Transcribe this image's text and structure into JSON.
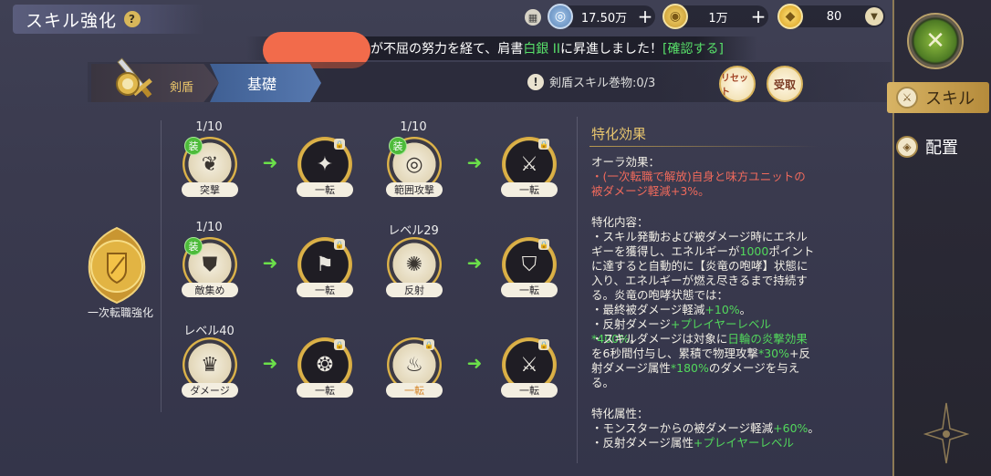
{
  "header": {
    "title": "スキル強化",
    "help_icon": "?"
  },
  "currencies": {
    "silver": {
      "value": "17.50万"
    },
    "gold": {
      "value": "1万"
    },
    "gem": {
      "value": "80"
    }
  },
  "notice": {
    "text_before": "が不屈の努力を経て、肩書",
    "rank": "白銀 II",
    "text_after": "に昇進しました！",
    "confirm": "[確認する]"
  },
  "tabs": [
    {
      "label": "剣盾"
    },
    {
      "label": "基礎"
    }
  ],
  "scroll_info": "剣盾スキル巻物:0/3",
  "buttons": {
    "reset": "リセット",
    "receive": "受取"
  },
  "left_emblem_label": "一次転職強化",
  "skill_rows": [
    {
      "cells": [
        {
          "level": "1/10",
          "name": "突撃",
          "equipped": "装",
          "style": "gold"
        },
        {
          "level": "",
          "name": "一転",
          "style": "dark"
        },
        {
          "level": "1/10",
          "name": "範囲攻撃",
          "equipped": "装",
          "style": "gold"
        },
        {
          "level": "",
          "name": "一転",
          "style": "dark"
        }
      ]
    },
    {
      "cells": [
        {
          "level": "1/10",
          "name": "敵集め",
          "equipped": "装",
          "style": "gold"
        },
        {
          "level": "",
          "name": "一転",
          "style": "dark"
        },
        {
          "level": "レベル29",
          "name": "反射",
          "style": "gold"
        },
        {
          "level": "",
          "name": "一転",
          "style": "dark"
        }
      ]
    },
    {
      "cells": [
        {
          "level": "レベル40",
          "name": "ダメージ",
          "style": "gold"
        },
        {
          "level": "",
          "name": "一転",
          "style": "dark"
        },
        {
          "level": "",
          "name": "一転",
          "style": "gold",
          "active": true
        },
        {
          "level": "",
          "name": "一転",
          "style": "dark"
        }
      ]
    }
  ],
  "panel": {
    "title": "特化効果",
    "aura_heading": "オーラ効果：",
    "aura_line1": "・(一次転職で解放)自身と味方ユニットの",
    "aura_line2": "被ダメージ軽減+3%。",
    "content_heading": "特化内容：",
    "c1": "・スキル発動および被ダメージ時にエネル",
    "c2a": "ギーを獲得し、エネルギーが",
    "c2b": "1000",
    "c2c": "ポイント",
    "c3": "に達すると自動的に【炎竜の咆哮】状態に",
    "c4": "入り、エネルギーが燃え尽きるまで持続す",
    "c5": "る。炎竜の咆哮状態では：",
    "c6a": "・最終被ダメージ軽減",
    "c6b": "+10%",
    "c6c": "。",
    "c7a": "・反射ダメージ",
    "c7b": "+プレイヤーレベル*400%",
    "c7c": "。",
    "c8a": "・スキルダメージは対象に",
    "c8b": "日輪の炎撃効果",
    "c9": "を6秒間付与し、累積で物理攻撃",
    "c9b": "*30%",
    "c9c": "+反",
    "c10a": "射ダメージ属性",
    "c10b": "*180%",
    "c10c": "のダメージを与え",
    "c11": "る。",
    "attr_heading": "特化属性：",
    "a1a": "・モンスターからの被ダメージ軽減",
    "a1b": "+60%",
    "a1c": "。",
    "a2a": "・反射ダメージ属性",
    "a2b": "+プレイヤーレベル"
  },
  "side_nav": {
    "items": [
      {
        "label": "スキル",
        "active": true
      },
      {
        "label": "配置",
        "active": false
      }
    ]
  },
  "colors": {
    "accent_gold": "#d8b465",
    "highlight_green": "#52d85c",
    "highlight_red": "#f06a5c",
    "tab_blue": "#4f70a8"
  }
}
